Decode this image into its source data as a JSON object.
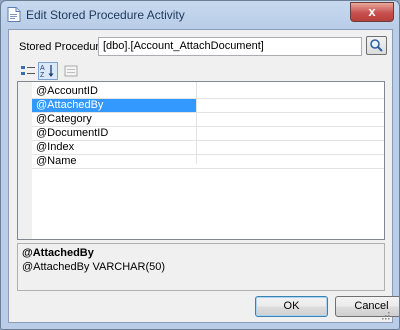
{
  "window": {
    "title": "Edit Stored Procedure Activity",
    "close_label": "x"
  },
  "stored_procedure": {
    "label": "Stored Procedure:",
    "value": "[dbo].[Account_AttachDocument]"
  },
  "toolbar": {
    "categorized_icon": "categorized-view-icon",
    "alphabetical_icon": "sort-alphabetical-icon",
    "property_pages_icon": "property-pages-icon"
  },
  "parameters": [
    {
      "name": "@AccountID"
    },
    {
      "name": "@AttachedBy",
      "selected": true
    },
    {
      "name": "@Category"
    },
    {
      "name": "@DocumentID"
    },
    {
      "name": "@Index"
    },
    {
      "name": "@Name"
    }
  ],
  "description": {
    "title": "@AttachedBy",
    "text": "@AttachedBy VARCHAR(50)"
  },
  "buttons": {
    "ok": "OK",
    "cancel": "Cancel"
  },
  "colors": {
    "selection": "#3399ff",
    "title_text": "#1e395b",
    "close_button": "#c75050"
  }
}
